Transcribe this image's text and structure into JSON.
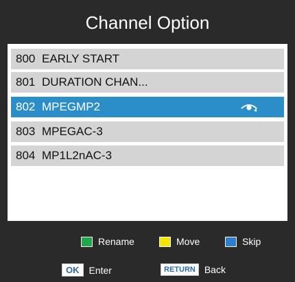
{
  "header": {
    "title": "Channel Option"
  },
  "channels": [
    {
      "number": "800",
      "name": "EARLY START",
      "selected": false
    },
    {
      "number": "801",
      "name": "DURATION CHAN...",
      "selected": false
    },
    {
      "number": "802",
      "name": "MPEGMP2",
      "selected": true,
      "skip_icon": "skip-eye-icon"
    },
    {
      "number": "803",
      "name": "MPEGAC-3",
      "selected": false
    },
    {
      "number": "804",
      "name": "MP1L2nAC-3",
      "selected": false
    }
  ],
  "legend": {
    "rename": {
      "label": "Rename",
      "color": "#22a84a"
    },
    "move": {
      "label": "Move",
      "color": "#f5e600"
    },
    "skip": {
      "label": "Skip",
      "color": "#2b7ed0"
    }
  },
  "keys": {
    "ok": {
      "key": "OK",
      "label": "Enter"
    },
    "return": {
      "key": "RETURN",
      "label": "Back"
    }
  },
  "colors": {
    "frame": "#2a2a2a",
    "row": "#d4d4d4",
    "selected_row": "#2b8ec9"
  }
}
